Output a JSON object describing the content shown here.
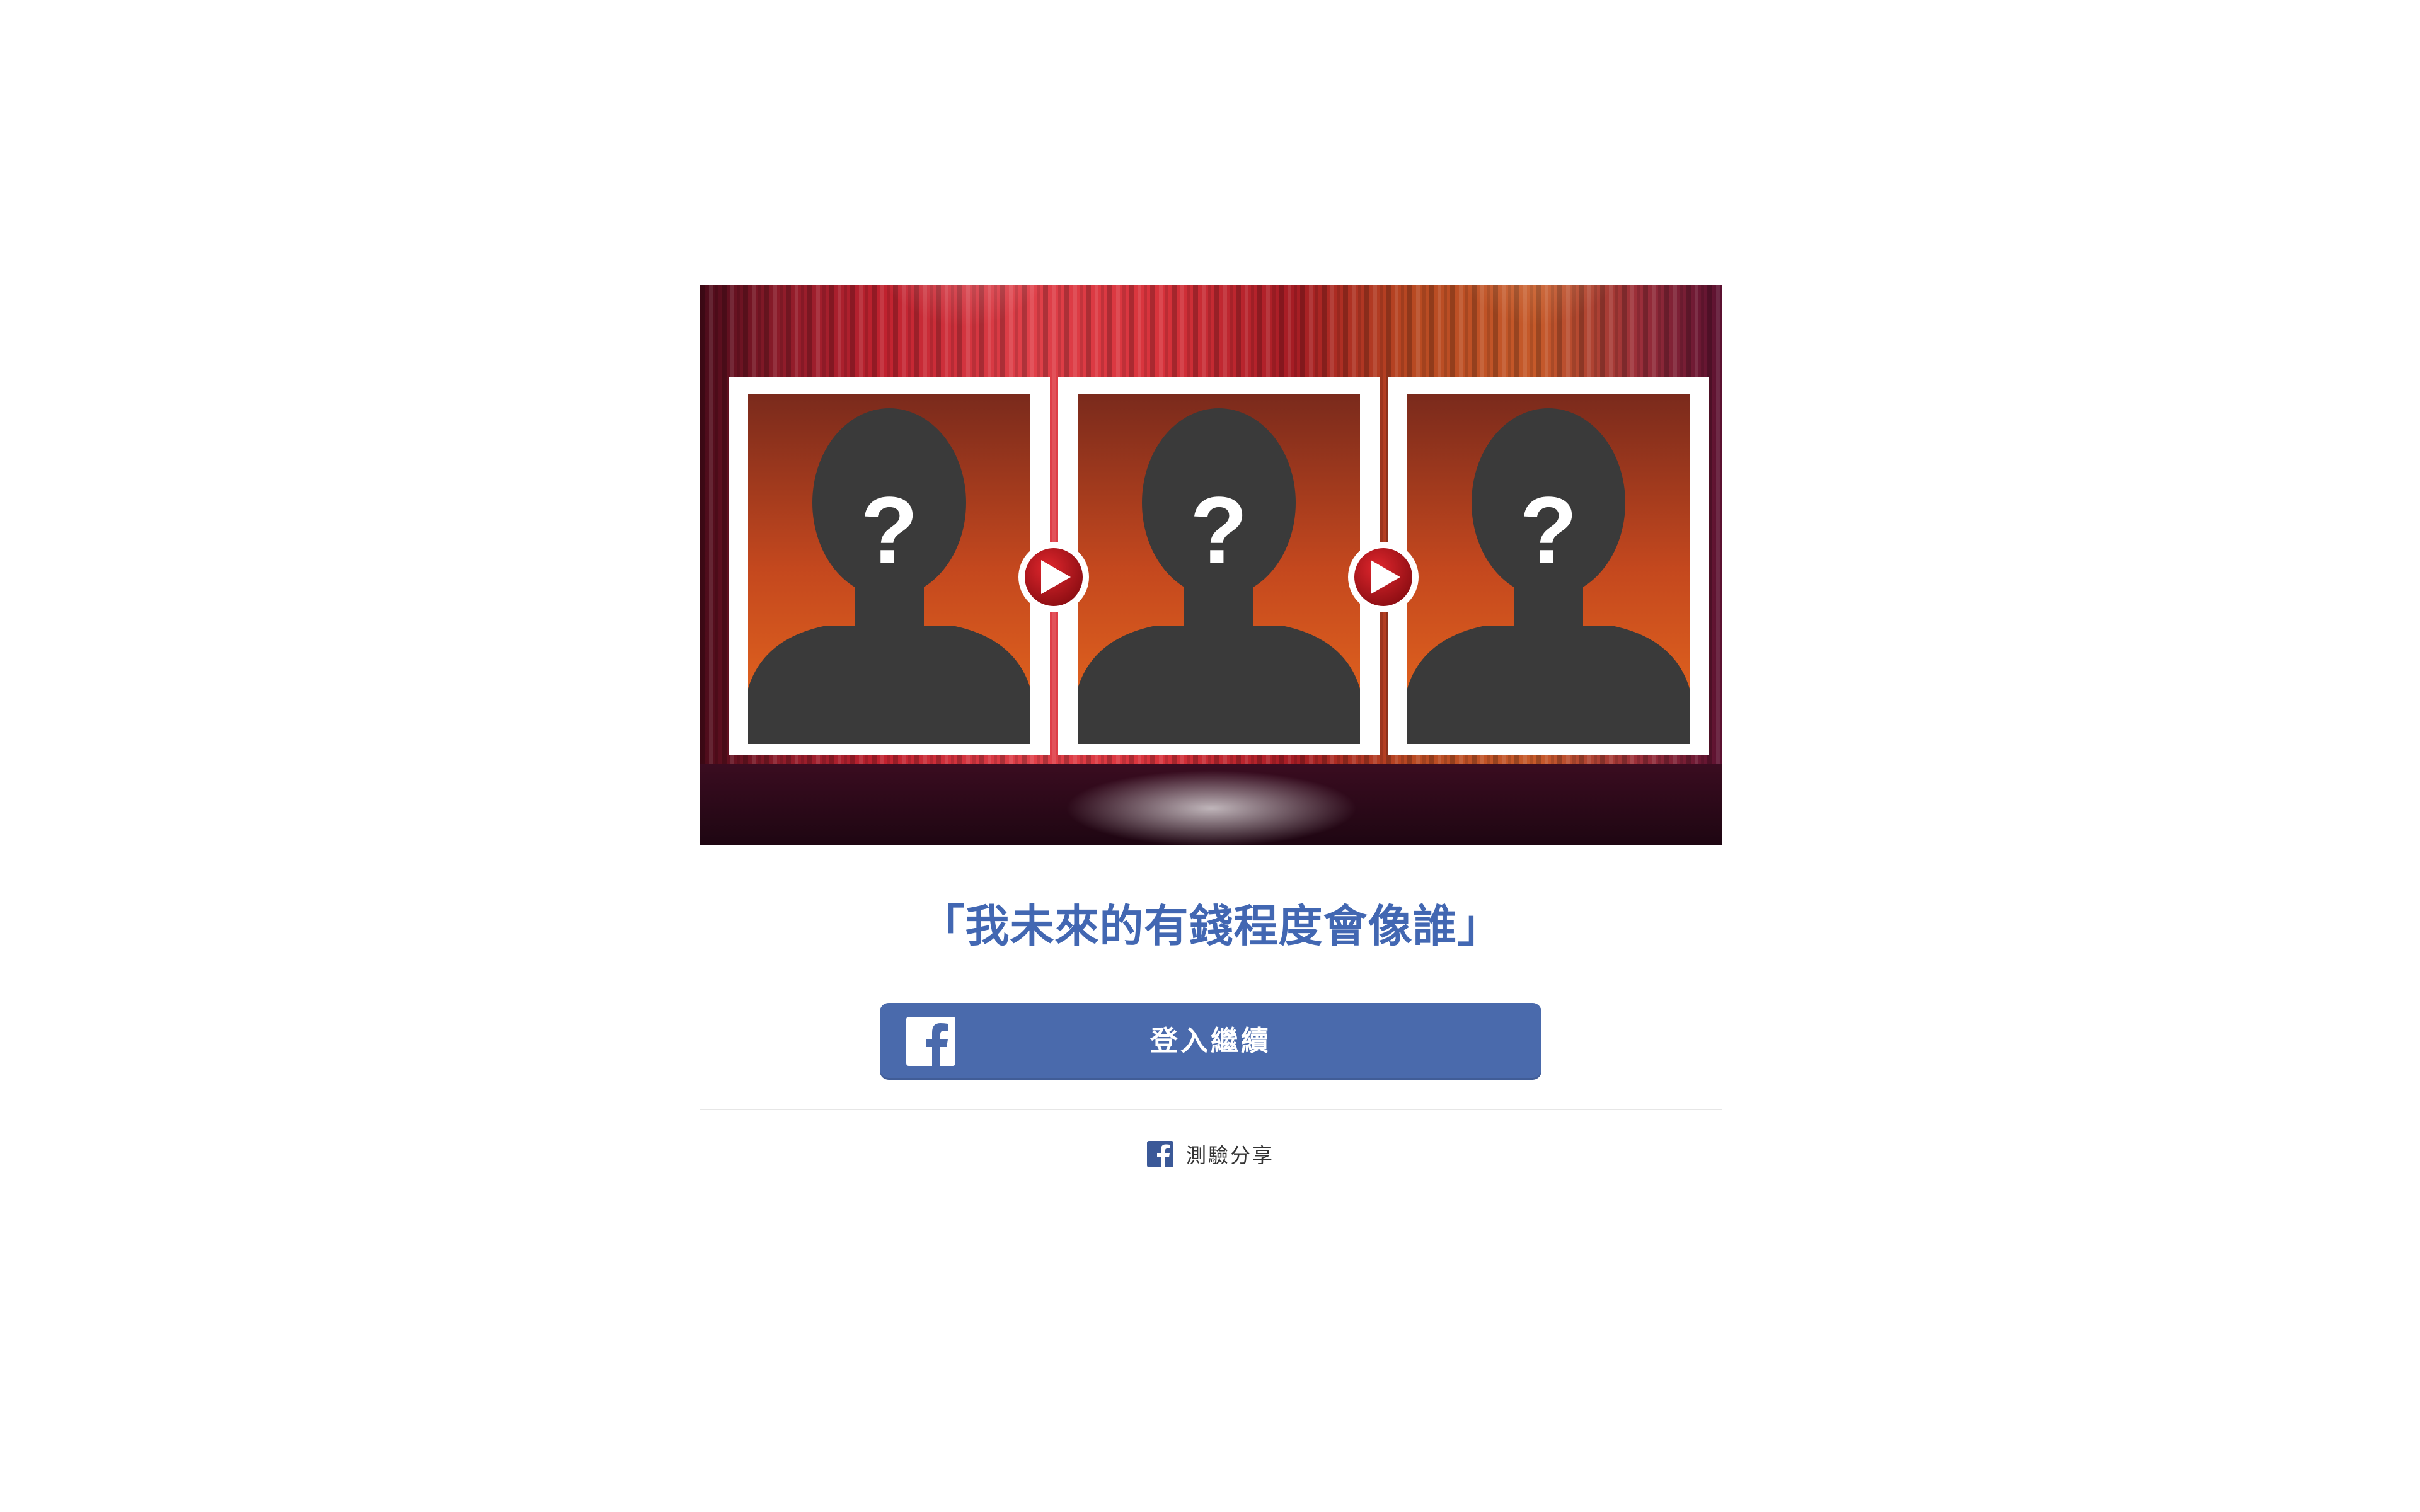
{
  "quiz": {
    "title": "「我未來的有錢程度會像誰」",
    "banner": {
      "portraits": [
        {
          "mark": "?"
        },
        {
          "mark": "?"
        },
        {
          "mark": "?"
        }
      ],
      "arrow_icon": "play-arrow-icon"
    }
  },
  "login": {
    "label": "登入繼續",
    "icon": "facebook-icon"
  },
  "share": {
    "label": "測驗分享",
    "icon": "facebook-icon"
  },
  "colors": {
    "brand_blue": "#4267b2",
    "button_blue": "#4a6aac",
    "silhouette": "#3a3a3a",
    "arrow_red": "#b0151b"
  }
}
